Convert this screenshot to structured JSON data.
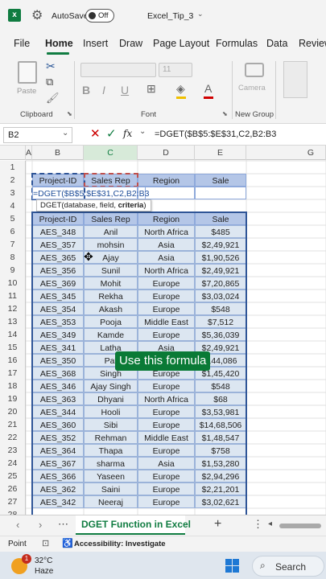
{
  "titlebar": {
    "autosave_label": "AutoSave",
    "toggle_state": "Off",
    "file_name": "Excel_Tip_3"
  },
  "menu": [
    "File",
    "Home",
    "Insert",
    "Draw",
    "Page Layout",
    "Formulas",
    "Data",
    "Review"
  ],
  "ribbon": {
    "paste_label": "Paste",
    "clipboard_label": "Clipboard",
    "font_label": "Font",
    "font_size": "11",
    "camera_label": "Camera",
    "new_group_label": "New Group"
  },
  "formula_bar": {
    "name_box": "B2",
    "fx": "fx",
    "formula": "=DGET($B$5:$E$31,C2,B2:B3"
  },
  "columns": [
    "A",
    "B",
    "C",
    "D",
    "E",
    "G"
  ],
  "rows": [
    "1",
    "2",
    "3",
    "4",
    "5",
    "6",
    "7",
    "8",
    "9",
    "10",
    "11",
    "12",
    "13",
    "14",
    "15",
    "16",
    "17",
    "18",
    "19",
    "20",
    "21",
    "22",
    "23",
    "24",
    "25",
    "26",
    "27",
    "28"
  ],
  "criteria": {
    "headers": [
      "Project-ID",
      "Sales Rep",
      "Region",
      "Sale"
    ],
    "editing": "=DGET($B$5:$E$31,C2,B2:B3"
  },
  "tooltip": {
    "prefix": "DGET(database, field, ",
    "bold": "criteria",
    ")": ")"
  },
  "table": {
    "headers": [
      "Project-ID",
      "Sales Rep",
      "Region",
      "Sale"
    ],
    "rows": [
      [
        "AES_348",
        "Anil",
        "North Africa",
        "$485"
      ],
      [
        "AES_357",
        "mohsin",
        "Asia",
        "$2,49,921"
      ],
      [
        "AES_365",
        "Ajay",
        "Asia",
        "$1,90,526"
      ],
      [
        "AES_356",
        "Sunil",
        "North Africa",
        "$2,49,921"
      ],
      [
        "AES_369",
        "Mohit",
        "Europe",
        "$7,20,865"
      ],
      [
        "AES_345",
        "Rekha",
        "Europe",
        "$3,03,024"
      ],
      [
        "AES_354",
        "Akash",
        "Europe",
        "$548"
      ],
      [
        "AES_353",
        "Pooja",
        "Middle East",
        "$7,512"
      ],
      [
        "AES_349",
        "Kamde",
        "Europe",
        "$5,36,039"
      ],
      [
        "AES_341",
        "Latha",
        "Asia",
        "$2,49,921"
      ],
      [
        "AES_350",
        "Pat",
        "",
        "4,44,086"
      ],
      [
        "AES_368",
        "Singh",
        "Europe",
        "$1,45,420"
      ],
      [
        "AES_346",
        "Ajay Singh",
        "Europe",
        "$548"
      ],
      [
        "AES_363",
        "Dhyani",
        "North Africa",
        "$68"
      ],
      [
        "AES_344",
        "Hooli",
        "Europe",
        "$3,53,981"
      ],
      [
        "AES_360",
        "Sibi",
        "Europe",
        "$14,68,506"
      ],
      [
        "AES_352",
        "Rehman",
        "Middle East",
        "$1,48,547"
      ],
      [
        "AES_364",
        "Thapa",
        "Europe",
        "$758"
      ],
      [
        "AES_367",
        "sharma",
        "Asia",
        "$1,53,280"
      ],
      [
        "AES_366",
        "Yaseen",
        "Europe",
        "$2,94,296"
      ],
      [
        "AES_362",
        "Saini",
        "Europe",
        "$2,21,201"
      ],
      [
        "AES_342",
        "Neeraj",
        "Europe",
        "$3,02,621"
      ]
    ]
  },
  "overlay_caption": "Use this formula",
  "sheet_tab": "DGET Function in Excel",
  "status": {
    "mode": "Point",
    "accessibility": "Accessibility: Investigate"
  },
  "taskbar": {
    "badge": "1",
    "temp": "32°C",
    "condition": "Haze",
    "search": "Search"
  }
}
